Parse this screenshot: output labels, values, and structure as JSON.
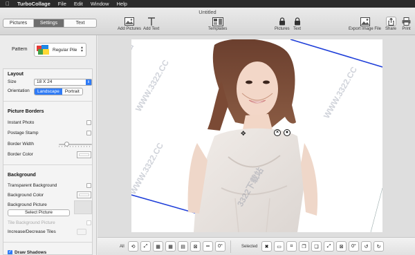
{
  "menubar": {
    "apple": "",
    "app_name": "TurboCollage",
    "items": [
      "File",
      "Edit",
      "Window",
      "Help"
    ]
  },
  "window": {
    "title": "Untitled"
  },
  "sidebar_tabs": [
    "Pictures",
    "Settings",
    "Text"
  ],
  "toolbar": {
    "add_pictures": "Add Pictures",
    "add_text": "Add Text",
    "templates": "Templates",
    "lock_pictures": "Pictures",
    "lock_text": "Text",
    "export": "Export Image File",
    "share": "Share",
    "print": "Print"
  },
  "pattern": {
    "label": "Pattern",
    "value": "Regular Pile"
  },
  "layout": {
    "title": "Layout",
    "size_label": "Size",
    "size_value": "18 X 24",
    "orientation_label": "Orientation",
    "orientation_options": [
      "Landscape",
      "Portrait"
    ],
    "orientation_selected": "Landscape"
  },
  "borders": {
    "title": "Picture Borders",
    "instant_photo": "Instant Photo",
    "postage_stamp": "Postage Stamp",
    "border_width": "Border Width",
    "border_width_level": 0.2,
    "border_color": "Border Color"
  },
  "background": {
    "title": "Background",
    "transparent": "Transparent Background",
    "color": "Background Color",
    "picture": "Background Picture",
    "select_picture": "Select Picture",
    "tile": "Tile Background Picture",
    "increase_decrease": "Increase/Decrease Tiles"
  },
  "shadows": {
    "label": "Draw Shadows"
  },
  "bottom": {
    "all_label": "All",
    "selected_label": "Selected",
    "zero_degrees": "0°"
  },
  "watermarks": [
    "3322下载站",
    "WWW.3322.CC"
  ],
  "colors": {
    "accent_blue": "#2f7bf6",
    "frame_line": "#1f3fd9"
  }
}
